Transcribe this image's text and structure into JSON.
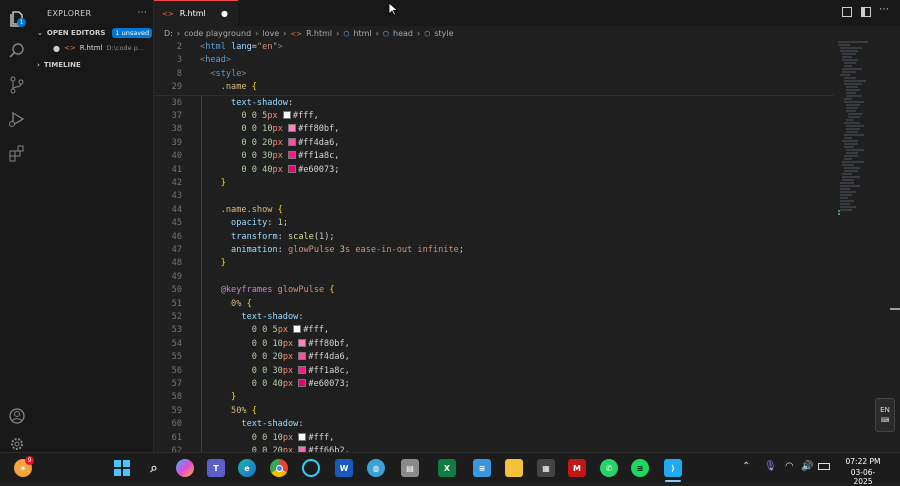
{
  "explorer": {
    "title": "EXPLORER",
    "open_editors": "OPEN EDITORS",
    "unsaved": "1 unsaved",
    "file_name": "R.html",
    "file_path": "D:\\code p...",
    "timeline": "TIMELINE",
    "more": "···"
  },
  "tab": {
    "label": "R.html"
  },
  "breadcrumb": [
    "D:",
    "code playground",
    "love",
    "R.html",
    "html",
    "head",
    "style"
  ],
  "lines": [
    {
      "n": "2",
      "t": "<html lang=\"en\">"
    },
    {
      "n": "3",
      "t": "<head>"
    },
    {
      "n": "8",
      "t": "  <style>"
    },
    {
      "n": "29",
      "t": "    .name {"
    },
    {
      "n": "36",
      "t": "      text-shadow:"
    },
    {
      "n": "37",
      "t": "        0 0 5px ",
      "c": "#ffffff",
      "s": "#fff,"
    },
    {
      "n": "38",
      "t": "        0 0 10px ",
      "c": "#ff80bf",
      "s": "#ff80bf,"
    },
    {
      "n": "39",
      "t": "        0 0 20px ",
      "c": "#ff4da6",
      "s": "#ff4da6,"
    },
    {
      "n": "40",
      "t": "        0 0 30px ",
      "c": "#ff1a8c",
      "s": "#ff1a8c,"
    },
    {
      "n": "41",
      "t": "        0 0 40px ",
      "c": "#e60073",
      "s": "#e60073;"
    },
    {
      "n": "42",
      "t": "    }"
    },
    {
      "n": "43",
      "t": ""
    },
    {
      "n": "44",
      "t": "    .name.show {"
    },
    {
      "n": "45",
      "t": "      opacity: 1;"
    },
    {
      "n": "46",
      "t": "      transform: scale(1);"
    },
    {
      "n": "47",
      "t": "      animation: glowPulse 3s ease-in-out infinite;"
    },
    {
      "n": "48",
      "t": "    }"
    },
    {
      "n": "49",
      "t": ""
    },
    {
      "n": "50",
      "t": "    @keyframes glowPulse {"
    },
    {
      "n": "51",
      "t": "      0% {"
    },
    {
      "n": "52",
      "t": "        text-shadow:"
    },
    {
      "n": "53",
      "t": "          0 0 5px ",
      "c": "#ffffff",
      "s": "#fff,"
    },
    {
      "n": "54",
      "t": "          0 0 10px ",
      "c": "#ff80bf",
      "s": "#ff80bf,"
    },
    {
      "n": "55",
      "t": "          0 0 20px ",
      "c": "#ff4da6",
      "s": "#ff4da6,"
    },
    {
      "n": "56",
      "t": "          0 0 30px ",
      "c": "#ff1a8c",
      "s": "#ff1a8c,"
    },
    {
      "n": "57",
      "t": "          0 0 40px ",
      "c": "#e60073",
      "s": "#e60073;"
    },
    {
      "n": "58",
      "t": "      }"
    },
    {
      "n": "59",
      "t": "      50% {"
    },
    {
      "n": "60",
      "t": "        text-shadow:"
    },
    {
      "n": "61",
      "t": "          0 0 10px ",
      "c": "#ffffff",
      "s": "#fff,"
    },
    {
      "n": "62",
      "t": "          0 0 20px ",
      "c": "#ff66b2",
      "s": "#ff66b2,"
    }
  ],
  "status": {
    "lang": "EN"
  },
  "taskbar": {
    "time": "07:22 PM",
    "date": "03-06-2025",
    "notif": "9"
  },
  "colors": {
    "accent": "#0078d4",
    "tab_border": "#f14c4c"
  }
}
